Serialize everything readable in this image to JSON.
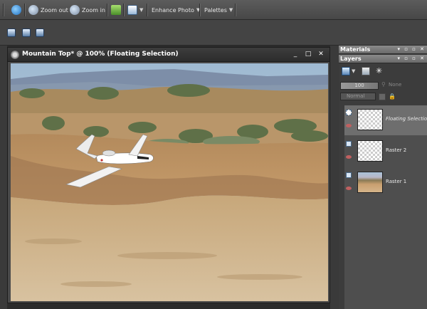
{
  "toolbar": {
    "zoom_out_label": "Zoom out",
    "zoom_in_label": "Zoom in",
    "enhance_photo_label": "Enhance Photo",
    "palettes_label": "Palettes"
  },
  "image_window": {
    "title": "Mountain Top* @ 100% (Floating Selection)"
  },
  "panels": {
    "materials_title": "Materials",
    "layers_title": "Layers",
    "opacity_value": "100",
    "selection_label": "None",
    "blend_mode": "Normal",
    "layers": [
      {
        "name": "Floating Selection",
        "selected": true
      },
      {
        "name": "Raster 2",
        "selected": false
      },
      {
        "name": "Raster 1",
        "selected": false
      }
    ]
  },
  "colors": {
    "app_background": "#2b2b2b",
    "toolbar": "#505050",
    "selected_layer": "#6e6e6e",
    "sky": "#a9c2d8",
    "sand": "#c9a070"
  },
  "icons": [
    "info-icon",
    "zoom-out-icon",
    "zoom-in-icon",
    "photo-icon",
    "layers-icon",
    "eye-icon"
  ]
}
